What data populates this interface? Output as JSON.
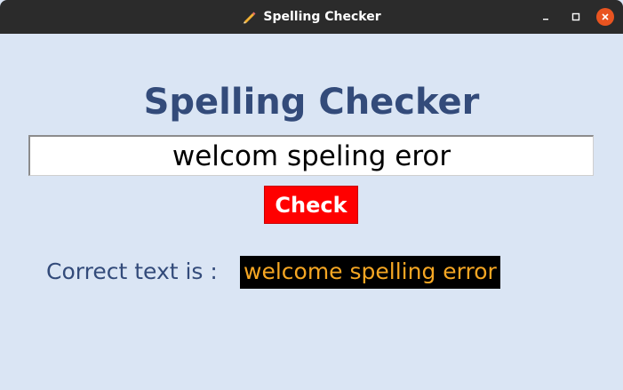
{
  "window": {
    "title": "Spelling Checker",
    "title_icon": "pencil-icon"
  },
  "app": {
    "heading": "Spelling Checker",
    "input_value": "welcom speling eror",
    "check_label": "Check",
    "result_label": "Correct text is : ",
    "result_value": "welcome spelling error"
  },
  "colors": {
    "background": "#dae5f4",
    "heading": "#334b7a",
    "button_bg": "#ff0000",
    "button_text": "#ffffff",
    "result_bg": "#000000",
    "result_text": "#f5a623",
    "titlebar": "#2b2b2b",
    "close_button": "#e95420"
  }
}
